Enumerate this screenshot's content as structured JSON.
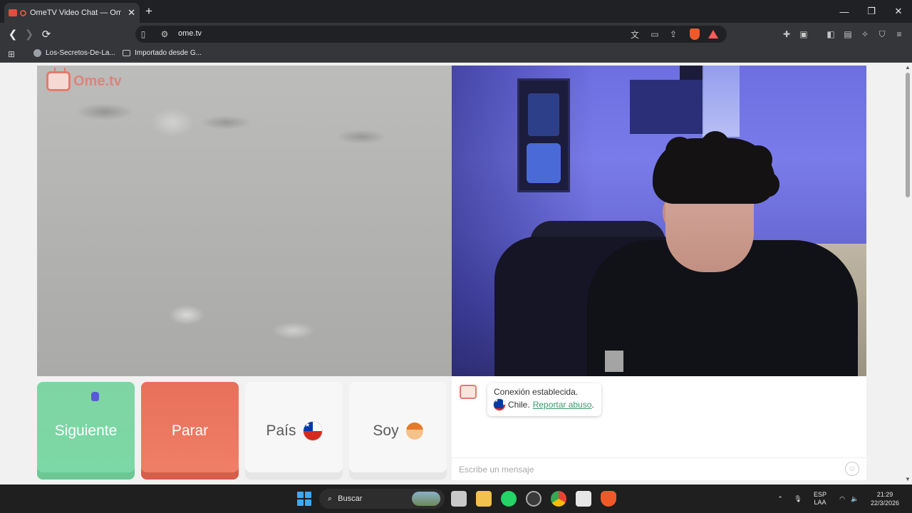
{
  "browser": {
    "tab_title": "OmeTV Video Chat — Omegle",
    "url": "ome.tv",
    "bookmarks": [
      "Los-Secretos-De-La...",
      "Importado desde G..."
    ]
  },
  "page": {
    "logo_text": "Ome.tv",
    "buttons": {
      "next": "Siguiente",
      "stop": "Parar",
      "country": "País",
      "gender": "Soy"
    },
    "chat": {
      "message_line1": "Conexión establecida.",
      "country_name": "Chile.",
      "report_link": "Reportar abuso",
      "report_suffix": ".",
      "input_placeholder": "Escribe un mensaje"
    }
  },
  "taskbar": {
    "search_label": "Buscar",
    "lang_primary": "ESP",
    "lang_secondary": "LAA",
    "time": "21:29",
    "date": "22/3/2026"
  },
  "colors": {
    "next_button": "#7ed5a3",
    "stop_button": "#e8705b",
    "brand": "#e37b6e"
  }
}
